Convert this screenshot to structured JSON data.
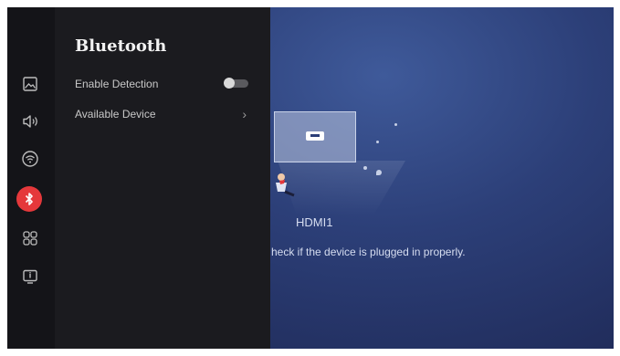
{
  "colors": {
    "active": "#e5383b",
    "panel": "#1b1b1f",
    "rail": "#141418",
    "background": "#2c3f78"
  },
  "sidebar": {
    "items": [
      {
        "icon": "picture-icon",
        "active": false
      },
      {
        "icon": "sound-icon",
        "active": false
      },
      {
        "icon": "network-icon",
        "active": false
      },
      {
        "icon": "bluetooth-icon",
        "active": true
      },
      {
        "icon": "apps-icon",
        "active": false
      },
      {
        "icon": "system-info-icon",
        "active": false
      }
    ]
  },
  "panel": {
    "title": "Bluetooth",
    "items": [
      {
        "label": "Enable Detection",
        "control": "toggle",
        "enabled": false
      },
      {
        "label": "Available Device",
        "control": "chevron"
      }
    ]
  },
  "background": {
    "source_name": "HDMI1",
    "hint": "heck if the device is plugged in properly."
  }
}
